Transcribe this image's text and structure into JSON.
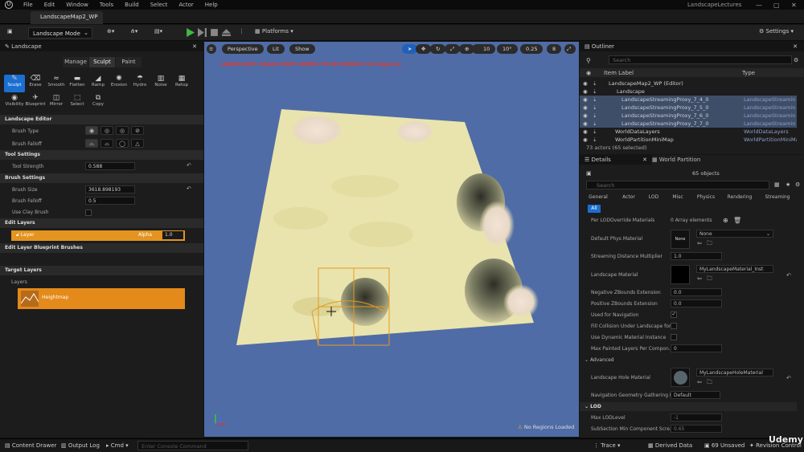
{
  "title_bar": {
    "menus": [
      "File",
      "Edit",
      "Window",
      "Tools",
      "Build",
      "Select",
      "Actor",
      "Help"
    ],
    "window_title": "LandscapeLectures"
  },
  "tab": {
    "label": "LandscapeMap2_WP"
  },
  "toolbar": {
    "mode": "Landscape Mode",
    "platforms": "Platforms",
    "settings": "Settings"
  },
  "left_panel": {
    "title": "Landscape",
    "modes": [
      "Manage",
      "Sculpt",
      "Paint"
    ],
    "tools_row1": [
      "Sculpt",
      "Erase",
      "Smooth",
      "Flatten",
      "Ramp",
      "Erosion",
      "Hydro",
      "Noise",
      "Retop"
    ],
    "tools_row2": [
      "Visibility",
      "Blueprint",
      "Mirror",
      "Select",
      "Copy"
    ],
    "landscape_editor": "Landscape Editor",
    "brush_type": "Brush Type",
    "brush_falloff": "Brush Falloff",
    "tool_settings": "Tool Settings",
    "tool_strength_label": "Tool Strength",
    "tool_strength_value": "0.588",
    "brush_settings": "Brush Settings",
    "brush_size_label": "Brush Size",
    "brush_size_value": "3618.898193",
    "brush_falloff_label": "Brush Falloff",
    "brush_falloff_value": "0.5",
    "use_clay_brush": "Use Clay Brush",
    "edit_layers": "Edit Layers",
    "layer_name": "Layer",
    "alpha_label": "Alpha",
    "alpha_value": "1.0",
    "edit_layer_bp_brushes": "Edit Layer Blueprint Brushes",
    "target_layers": "Target Layers",
    "layers": "Layers",
    "heightmap": "Heightmap"
  },
  "viewport": {
    "perspective": "Perspective",
    "lit": "Lit",
    "show": "Show",
    "grid_snap": "10",
    "rot_snap": "10°",
    "scale_snap": "0.25",
    "camera_speed": "8",
    "warning": "LANDSCAPE: GRASS MAPS NEEDS TO BE REBUILT (49 objects)",
    "no_regions": "No Regions Loaded"
  },
  "outliner": {
    "title": "Outliner",
    "search_placeholder": "Search",
    "col_label": "Item Label",
    "col_type": "Type",
    "rows": [
      {
        "label": "LandscapeMap2_WP (Editor)",
        "type": "",
        "sel": false,
        "indent": 36
      },
      {
        "label": "Landscape",
        "type": "",
        "sel": false,
        "indent": 46
      },
      {
        "label": "LandscapeStreamingProxy_7_4_0",
        "type": "LandscapeStreamin",
        "sel": true,
        "indent": 52
      },
      {
        "label": "LandscapeStreamingProxy_7_5_0",
        "type": "LandscapeStreamin",
        "sel": true,
        "indent": 52
      },
      {
        "label": "LandscapeStreamingProxy_7_6_0",
        "type": "LandscapeStreamin",
        "sel": true,
        "indent": 52
      },
      {
        "label": "LandscapeStreamingProxy_7_7_0",
        "type": "LandscapeStreamin",
        "sel": true,
        "indent": 52
      },
      {
        "label": "WorldDataLayers",
        "type": "WorldDataLayers",
        "sel": false,
        "indent": 44
      },
      {
        "label": "WorldPartitionMiniMap",
        "type": "WorldPartitionMiniMap",
        "sel": false,
        "indent": 44
      }
    ],
    "count": "73 actors (65 selected)"
  },
  "details": {
    "title": "Details",
    "world_partition": "World Partition",
    "objects": "65 objects",
    "search_placeholder": "Search",
    "tabs": [
      "General",
      "Actor",
      "LOD",
      "Misc",
      "Physics",
      "Rendering",
      "Streaming"
    ],
    "all": "All",
    "per_lod_override": "Per LODOverride Materials",
    "array_elements": "0 Array elements",
    "default_phys": "Default Phys Material",
    "none": "None",
    "none_thumb": "None",
    "streaming_distance": "Streaming Distance Multiplier",
    "streaming_distance_value": "1.0",
    "landscape_material": "Landscape Material",
    "landscape_material_value": "MyLandscapeMaterial_Inst",
    "neg_z": "Negative ZBounds Extension",
    "neg_z_value": "0.0",
    "pos_z": "Positive ZBounds Extension",
    "pos_z_value": "0.0",
    "used_for_nav": "Used for Navigation",
    "fill_collision": "Fill Collision Under Landscape for...",
    "use_dynamic": "Use Dynamic Material Instance",
    "max_painted": "Max Painted Layers Per Compon...",
    "max_painted_value": "0",
    "advanced": "Advanced",
    "hole_material": "Landscape Hole Material",
    "hole_material_value": "MyLandscapeHoleMaterial",
    "nav_geom": "Navigation Geometry Gathering M...",
    "nav_geom_value": "Default",
    "lod": "LOD",
    "max_lod": "Max LODLevel",
    "max_lod_value": "-1",
    "subsection": "SubSection Min Component Scre...",
    "subsection_value": "0.65"
  },
  "status_bar": {
    "content_drawer": "Content Drawer",
    "output_log": "Output Log",
    "cmd": "Cmd",
    "console_placeholder": "Enter Console Command",
    "trace": "Trace",
    "derived": "Derived Data",
    "unsaved": "69 Unsaved",
    "revision": "Revision Control",
    "watermark": "Udemy"
  },
  "colors": {
    "accent": "#1a6fd0",
    "layer": "#e39420",
    "warning": "#e03a30",
    "terrain": "#e9e4ad",
    "sky": "#506ca6"
  }
}
